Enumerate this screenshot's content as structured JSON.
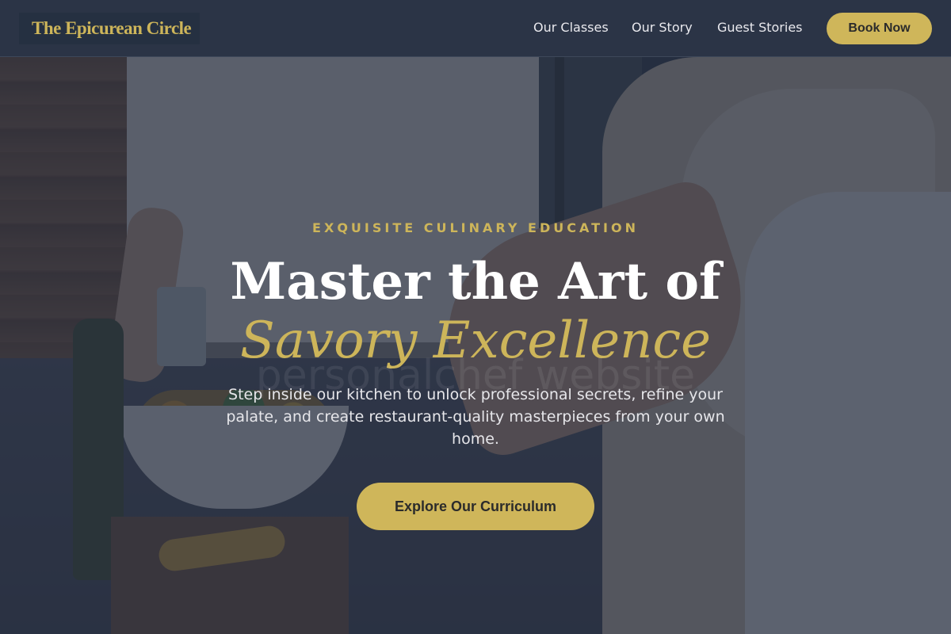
{
  "header": {
    "logo": "The Epicurean Circle",
    "nav": [
      {
        "label": "Our Classes"
      },
      {
        "label": "Our Story"
      },
      {
        "label": "Guest Stories"
      }
    ],
    "book_label": "Book Now"
  },
  "hero": {
    "eyebrow": "EXQUISITE CULINARY EDUCATION",
    "headline": "Master the Art of",
    "headline_accent": "Savory Excellence",
    "watermark": "personalchef website",
    "subtext": "Step inside our kitchen to unlock professional secrets, refine your palate, and create restaurant-quality masterpieces from your own home.",
    "cta_label": "Explore Our Curriculum"
  },
  "colors": {
    "header_bg": "#2b3446",
    "accent_gold": "#cfb65a",
    "overlay": "#242c3e"
  }
}
